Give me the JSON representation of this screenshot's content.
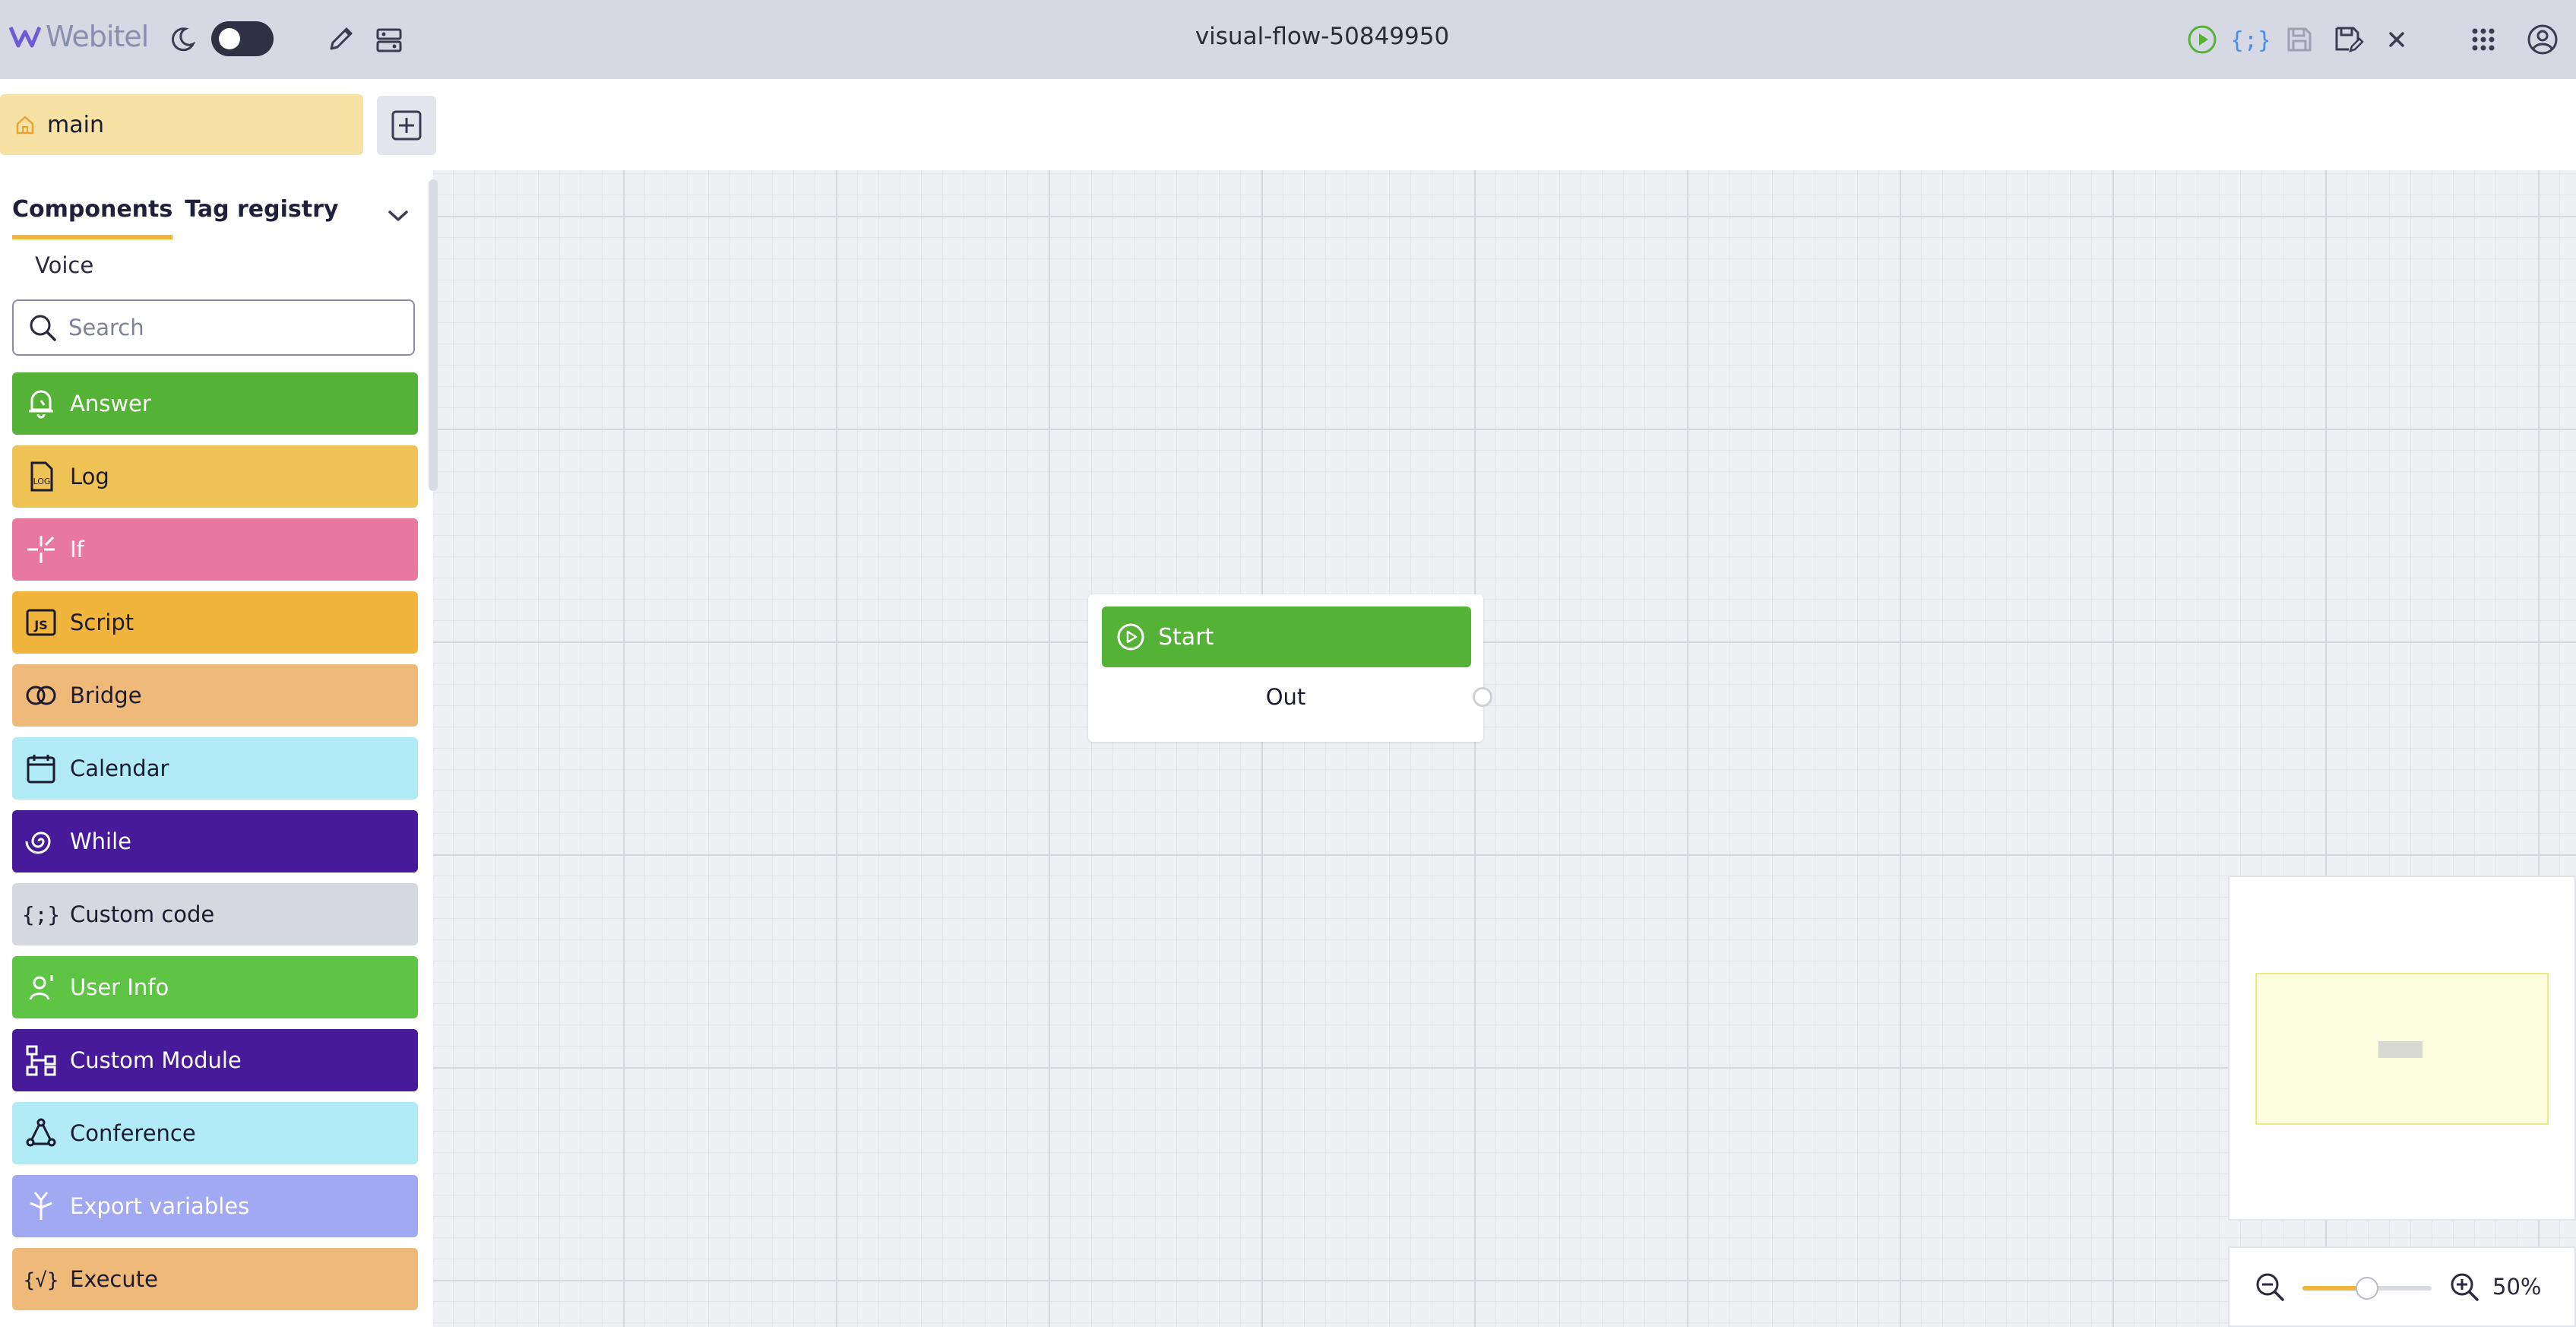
{
  "app": {
    "logo_text": "Webitel",
    "title": "visual-flow-50849950",
    "accent": "#6b5bd6",
    "theme_toggle": "off"
  },
  "tabs": [
    {
      "label": "main",
      "icon": "home-icon",
      "color": "#f7e2a6"
    }
  ],
  "sidebar": {
    "tabs": [
      "Components",
      "Tag registry"
    ],
    "active_tab": "Components",
    "category": "Voice",
    "search_placeholder": "Search",
    "components": [
      {
        "label": "Answer",
        "icon": "bell-icon",
        "color": "#54b237",
        "text_color": "#ffffff"
      },
      {
        "label": "Log",
        "icon": "log-file-icon",
        "color": "#efc255",
        "text_color": "#1b1b2f"
      },
      {
        "label": "If",
        "icon": "branch-icon",
        "color": "#e8789f",
        "text_color": "#ffffff"
      },
      {
        "label": "Script",
        "icon": "js-script-icon",
        "color": "#f2b53c",
        "text_color": "#1b1b2f"
      },
      {
        "label": "Bridge",
        "icon": "bridge-icon",
        "color": "#efb97a",
        "text_color": "#1b1b2f"
      },
      {
        "label": "Calendar",
        "icon": "calendar-icon",
        "color": "#b1ebf5",
        "text_color": "#1b1b2f"
      },
      {
        "label": "While",
        "icon": "spiral-icon",
        "color": "#471a99",
        "text_color": "#ffffff"
      },
      {
        "label": "Custom code",
        "icon": "code-braces-icon",
        "color": "#d6d8e0",
        "text_color": "#1b1b2f"
      },
      {
        "label": "User Info",
        "icon": "user-info-icon",
        "color": "#5dc543",
        "text_color": "#ffffff"
      },
      {
        "label": "Custom Module",
        "icon": "module-tree-icon",
        "color": "#471a99",
        "text_color": "#ffffff"
      },
      {
        "label": "Conference",
        "icon": "conference-icon",
        "color": "#b1ebf5",
        "text_color": "#1b1b2f"
      },
      {
        "label": "Export variables",
        "icon": "export-vars-icon",
        "color": "#a2a9f3",
        "text_color": "#ffffff"
      },
      {
        "label": "Execute",
        "icon": "execute-icon",
        "color": "#efb97a",
        "text_color": "#1b1b2f"
      }
    ]
  },
  "node": {
    "title": "Start",
    "output": "Out",
    "color": "#54b237"
  },
  "zoom": {
    "label": "50%",
    "level": 0.5
  }
}
